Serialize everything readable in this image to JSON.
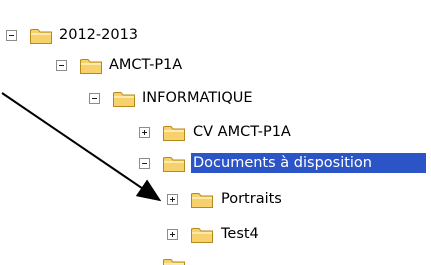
{
  "tree": {
    "nodes": [
      {
        "id": "2012-2013",
        "label": "2012-2013",
        "expander": "minus",
        "selected": false
      },
      {
        "id": "amct-p1a",
        "label": "AMCT-P1A",
        "expander": "minus",
        "selected": false
      },
      {
        "id": "informatique",
        "label": "INFORMATIQUE",
        "expander": "minus",
        "selected": false
      },
      {
        "id": "cv-amct-p1a",
        "label": "CV AMCT-P1A",
        "expander": "plus",
        "selected": false
      },
      {
        "id": "documents",
        "label": "Documents à disposition",
        "expander": "minus",
        "selected": true
      },
      {
        "id": "portraits",
        "label": "Portraits",
        "expander": "plus",
        "selected": false
      },
      {
        "id": "test4",
        "label": "Test4",
        "expander": "plus",
        "selected": false
      }
    ]
  },
  "icons": {
    "expander_minus": "minus-box-icon",
    "expander_plus": "plus-box-icon",
    "folder": "folder-icon"
  },
  "colors": {
    "selection": "#2b55c7",
    "folder_fill": "#f7d16c",
    "folder_stroke": "#b58a1d",
    "arrow": "#000000"
  }
}
